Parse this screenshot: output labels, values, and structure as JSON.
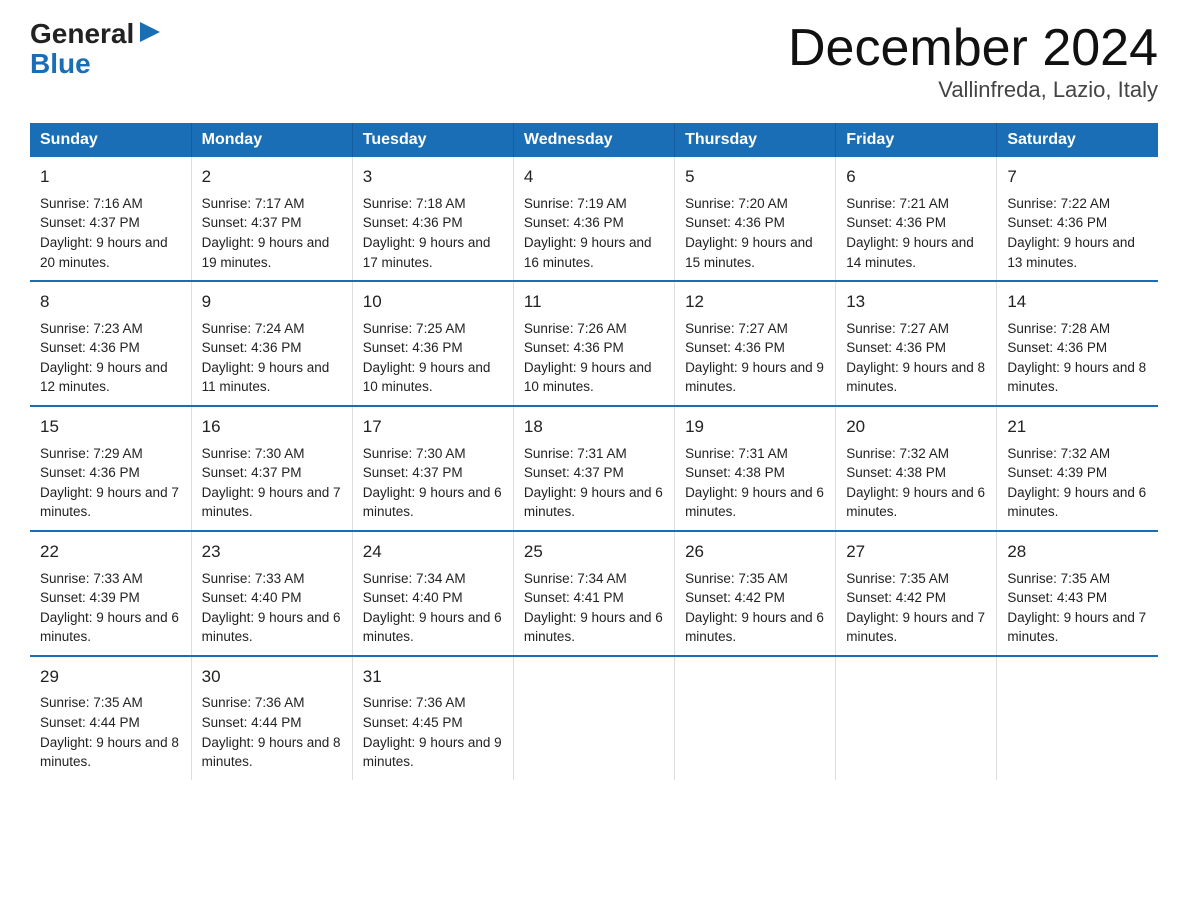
{
  "header": {
    "logo_general": "General",
    "logo_blue": "Blue",
    "title": "December 2024",
    "subtitle": "Vallinfreda, Lazio, Italy"
  },
  "days_of_week": [
    "Sunday",
    "Monday",
    "Tuesday",
    "Wednesday",
    "Thursday",
    "Friday",
    "Saturday"
  ],
  "weeks": [
    [
      {
        "day": "1",
        "sunrise": "7:16 AM",
        "sunset": "4:37 PM",
        "daylight": "9 hours and 20 minutes."
      },
      {
        "day": "2",
        "sunrise": "7:17 AM",
        "sunset": "4:37 PM",
        "daylight": "9 hours and 19 minutes."
      },
      {
        "day": "3",
        "sunrise": "7:18 AM",
        "sunset": "4:36 PM",
        "daylight": "9 hours and 17 minutes."
      },
      {
        "day": "4",
        "sunrise": "7:19 AM",
        "sunset": "4:36 PM",
        "daylight": "9 hours and 16 minutes."
      },
      {
        "day": "5",
        "sunrise": "7:20 AM",
        "sunset": "4:36 PM",
        "daylight": "9 hours and 15 minutes."
      },
      {
        "day": "6",
        "sunrise": "7:21 AM",
        "sunset": "4:36 PM",
        "daylight": "9 hours and 14 minutes."
      },
      {
        "day": "7",
        "sunrise": "7:22 AM",
        "sunset": "4:36 PM",
        "daylight": "9 hours and 13 minutes."
      }
    ],
    [
      {
        "day": "8",
        "sunrise": "7:23 AM",
        "sunset": "4:36 PM",
        "daylight": "9 hours and 12 minutes."
      },
      {
        "day": "9",
        "sunrise": "7:24 AM",
        "sunset": "4:36 PM",
        "daylight": "9 hours and 11 minutes."
      },
      {
        "day": "10",
        "sunrise": "7:25 AM",
        "sunset": "4:36 PM",
        "daylight": "9 hours and 10 minutes."
      },
      {
        "day": "11",
        "sunrise": "7:26 AM",
        "sunset": "4:36 PM",
        "daylight": "9 hours and 10 minutes."
      },
      {
        "day": "12",
        "sunrise": "7:27 AM",
        "sunset": "4:36 PM",
        "daylight": "9 hours and 9 minutes."
      },
      {
        "day": "13",
        "sunrise": "7:27 AM",
        "sunset": "4:36 PM",
        "daylight": "9 hours and 8 minutes."
      },
      {
        "day": "14",
        "sunrise": "7:28 AM",
        "sunset": "4:36 PM",
        "daylight": "9 hours and 8 minutes."
      }
    ],
    [
      {
        "day": "15",
        "sunrise": "7:29 AM",
        "sunset": "4:36 PM",
        "daylight": "9 hours and 7 minutes."
      },
      {
        "day": "16",
        "sunrise": "7:30 AM",
        "sunset": "4:37 PM",
        "daylight": "9 hours and 7 minutes."
      },
      {
        "day": "17",
        "sunrise": "7:30 AM",
        "sunset": "4:37 PM",
        "daylight": "9 hours and 6 minutes."
      },
      {
        "day": "18",
        "sunrise": "7:31 AM",
        "sunset": "4:37 PM",
        "daylight": "9 hours and 6 minutes."
      },
      {
        "day": "19",
        "sunrise": "7:31 AM",
        "sunset": "4:38 PM",
        "daylight": "9 hours and 6 minutes."
      },
      {
        "day": "20",
        "sunrise": "7:32 AM",
        "sunset": "4:38 PM",
        "daylight": "9 hours and 6 minutes."
      },
      {
        "day": "21",
        "sunrise": "7:32 AM",
        "sunset": "4:39 PM",
        "daylight": "9 hours and 6 minutes."
      }
    ],
    [
      {
        "day": "22",
        "sunrise": "7:33 AM",
        "sunset": "4:39 PM",
        "daylight": "9 hours and 6 minutes."
      },
      {
        "day": "23",
        "sunrise": "7:33 AM",
        "sunset": "4:40 PM",
        "daylight": "9 hours and 6 minutes."
      },
      {
        "day": "24",
        "sunrise": "7:34 AM",
        "sunset": "4:40 PM",
        "daylight": "9 hours and 6 minutes."
      },
      {
        "day": "25",
        "sunrise": "7:34 AM",
        "sunset": "4:41 PM",
        "daylight": "9 hours and 6 minutes."
      },
      {
        "day": "26",
        "sunrise": "7:35 AM",
        "sunset": "4:42 PM",
        "daylight": "9 hours and 6 minutes."
      },
      {
        "day": "27",
        "sunrise": "7:35 AM",
        "sunset": "4:42 PM",
        "daylight": "9 hours and 7 minutes."
      },
      {
        "day": "28",
        "sunrise": "7:35 AM",
        "sunset": "4:43 PM",
        "daylight": "9 hours and 7 minutes."
      }
    ],
    [
      {
        "day": "29",
        "sunrise": "7:35 AM",
        "sunset": "4:44 PM",
        "daylight": "9 hours and 8 minutes."
      },
      {
        "day": "30",
        "sunrise": "7:36 AM",
        "sunset": "4:44 PM",
        "daylight": "9 hours and 8 minutes."
      },
      {
        "day": "31",
        "sunrise": "7:36 AM",
        "sunset": "4:45 PM",
        "daylight": "9 hours and 9 minutes."
      },
      null,
      null,
      null,
      null
    ]
  ],
  "labels": {
    "sunrise": "Sunrise:",
    "sunset": "Sunset:",
    "daylight": "Daylight:"
  }
}
